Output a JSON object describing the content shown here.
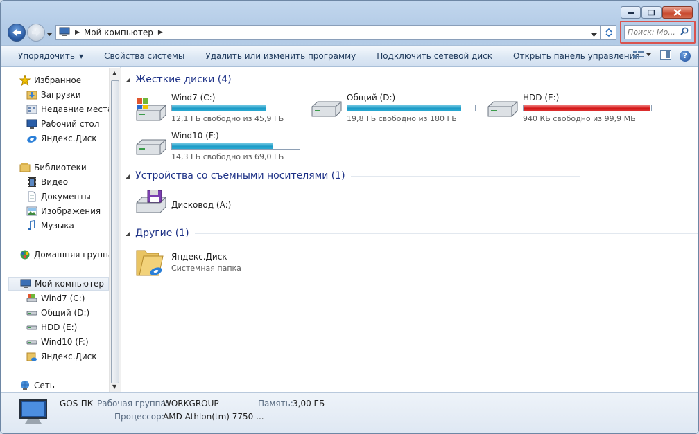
{
  "window": {
    "address": {
      "crumb": "Мой компьютер"
    },
    "search": {
      "placeholder": "Поиск: Мо..."
    }
  },
  "toolbar": {
    "organize": "Упорядочить",
    "system_properties": "Свойства системы",
    "uninstall": "Удалить или изменить программу",
    "map_drive": "Подключить сетевой диск",
    "control_panel": "Открыть панель управления"
  },
  "nav": {
    "favorites": "Избранное",
    "downloads": "Загрузки",
    "recent": "Недавние места",
    "desktop": "Рабочий стол",
    "yadisk_fav": "Яндекс.Диск",
    "libraries": "Библиотеки",
    "video": "Видео",
    "documents": "Документы",
    "images": "Изображения",
    "music": "Музыка",
    "homegroup": "Домашняя группа",
    "computer": "Мой компьютер",
    "c": "Wind7 (C:)",
    "d": "Общий (D:)",
    "e": "HDD (E:)",
    "f": "Wind10 (F:)",
    "yadisk": "Яндекс.Диск",
    "network": "Сеть"
  },
  "groups": {
    "hdd": "Жесткие диски (4)",
    "removable": "Устройства со съемными носителями (1)",
    "other": "Другие (1)"
  },
  "drives": [
    {
      "name": "Wind7 (C:)",
      "free": "12,1 ГБ свободно из 45,9 ГБ",
      "used_fraction": 0.736
    },
    {
      "name": "Общий (D:)",
      "free": "19,8 ГБ свободно из 180 ГБ",
      "used_fraction": 0.89
    },
    {
      "name": "HDD (E:)",
      "free": "940 КБ свободно из 99,9 МБ",
      "used_fraction": 0.99
    },
    {
      "name": "Wind10 (F:)",
      "free": "14,3 ГБ свободно из 69,0 ГБ",
      "used_fraction": 0.793
    }
  ],
  "removable": {
    "name": "Дисковод (A:)"
  },
  "other": {
    "name": "Яндекс.Диск",
    "desc": "Системная папка"
  },
  "status": {
    "pc_name": "GOS-ПК",
    "workgroup_label": "Рабочая группа:",
    "workgroup": "WORKGROUP",
    "memory_label": "Память:",
    "memory": "3,00 ГБ",
    "cpu_label": "Процессор:",
    "cpu": "AMD Athlon(tm) 7750 ..."
  },
  "colors": {
    "bar_normal": "#1d9bc6",
    "bar_full": "#d21717",
    "group_header": "#1e3287"
  }
}
